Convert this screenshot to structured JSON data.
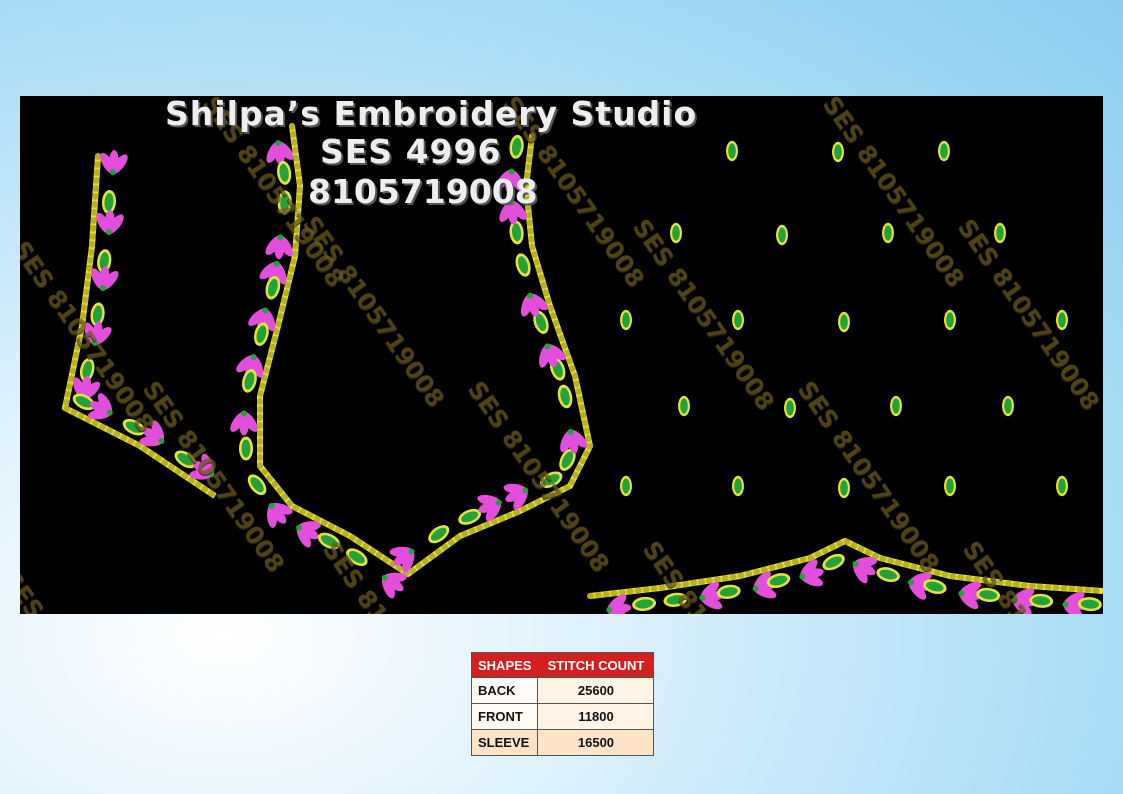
{
  "header": {
    "studio_name": "Shilpa’s  Embroidery  Studio",
    "design_code": "SES  4996",
    "phone": "8105719008"
  },
  "watermark": "SES 8105719008",
  "colors": {
    "background": "#000000",
    "petal": "#e34fdc",
    "leaf_fill": "#22a23a",
    "gold": "#e7e23a"
  },
  "table": {
    "headers": [
      "SHAPES",
      "STITCH COUNT"
    ],
    "rows": [
      {
        "shape": "BACK",
        "count": "25600"
      },
      {
        "shape": "FRONT",
        "count": "11800"
      },
      {
        "shape": "SLEEVE",
        "count": "16500"
      }
    ]
  }
}
